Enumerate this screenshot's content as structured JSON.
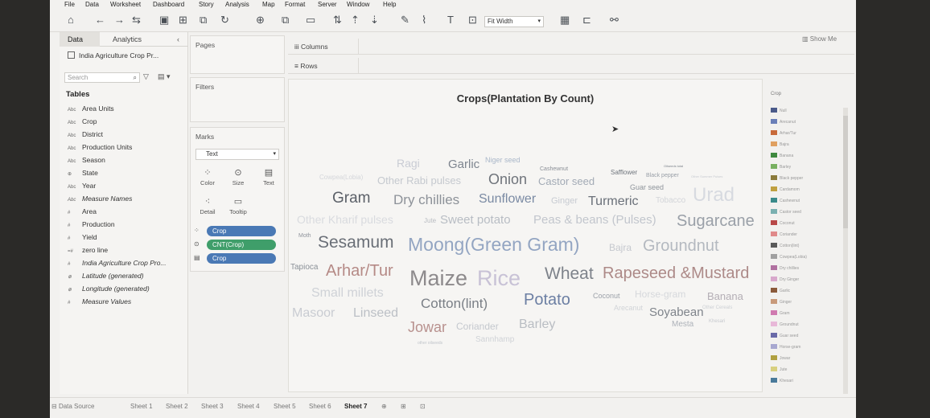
{
  "menu": [
    "File",
    "Data",
    "Worksheet",
    "Dashboard",
    "Story",
    "Analysis",
    "Map",
    "Format",
    "Server",
    "Window",
    "Help"
  ],
  "toolbar": {
    "fit": "Fit Width",
    "show_me": "Show Me"
  },
  "left_panel": {
    "tabs": {
      "data": "Data",
      "analytics": "Analytics"
    },
    "data_source": "India Agriculture Crop Pr...",
    "search_placeholder": "Search",
    "tables_heading": "Tables",
    "fields": [
      {
        "type": "Abc",
        "name": "Area Units",
        "italic": false
      },
      {
        "type": "Abc",
        "name": "Crop",
        "italic": false
      },
      {
        "type": "Abc",
        "name": "District",
        "italic": false
      },
      {
        "type": "Abc",
        "name": "Production Units",
        "italic": false
      },
      {
        "type": "Abc",
        "name": "Season",
        "italic": false
      },
      {
        "type": "globe",
        "name": "State",
        "italic": false
      },
      {
        "type": "Abc",
        "name": "Year",
        "italic": false
      },
      {
        "type": "Abc",
        "name": "Measure Names",
        "italic": true
      },
      {
        "type": "#",
        "name": "Area",
        "italic": false
      },
      {
        "type": "#",
        "name": "Production",
        "italic": false
      },
      {
        "type": "#",
        "name": "Yield",
        "italic": false
      },
      {
        "type": "=#",
        "name": "zero line",
        "italic": false
      },
      {
        "type": "#",
        "name": "India Agriculture Crop Pro...",
        "italic": true
      },
      {
        "type": "globe",
        "name": "Latitude (generated)",
        "italic": true
      },
      {
        "type": "globe",
        "name": "Longitude (generated)",
        "italic": true
      },
      {
        "type": "#",
        "name": "Measure Values",
        "italic": true
      }
    ]
  },
  "cards": {
    "pages": "Pages",
    "filters": "Filters",
    "marks": "Marks",
    "mark_type": "Text"
  },
  "mark_buttons": [
    "Color",
    "Size",
    "Text",
    "Detail",
    "Tooltip"
  ],
  "mark_pills": [
    {
      "label": "Crop",
      "color": "#4a79b5"
    },
    {
      "label": "CNT(Crop)",
      "color": "#3f9e6a"
    },
    {
      "label": "Crop",
      "color": "#4a79b5"
    }
  ],
  "shelves": {
    "columns": "Columns",
    "rows": "Rows"
  },
  "viz": {
    "title": "Crops(Plantation By Count)"
  },
  "chart_data": {
    "type": "word cloud",
    "words": [
      {
        "text": "Ragi",
        "color": "#c9ccd4"
      },
      {
        "text": "Garlic",
        "color": "#7e858f"
      },
      {
        "text": "Niger seed",
        "color": "#a9b6c8"
      },
      {
        "text": "Cashewnut",
        "color": "#8a8f96"
      },
      {
        "text": "Safflower",
        "color": "#6f757d"
      },
      {
        "text": "Black pepper",
        "color": "#9aa0a8"
      },
      {
        "text": "Other Summer Pulses",
        "color": "#c7cad0"
      },
      {
        "text": "Oilseeds total",
        "color": "#7d838b"
      },
      {
        "text": "Cowpea(Lobia)",
        "color": "#d4d6da"
      },
      {
        "text": "Other Rabi pulses",
        "color": "#c5c9cf"
      },
      {
        "text": "Onion",
        "color": "#6f747b"
      },
      {
        "text": "Castor seed",
        "color": "#a2aab5"
      },
      {
        "text": "Guar seed",
        "color": "#8e949b"
      },
      {
        "text": "Gram",
        "color": "#5b6068"
      },
      {
        "text": "Dry chillies",
        "color": "#8d9299"
      },
      {
        "text": "Sunflower",
        "color": "#7a8aa3"
      },
      {
        "text": "Ginger",
        "color": "#c7cbd2"
      },
      {
        "text": "Turmeric",
        "color": "#6a7079"
      },
      {
        "text": "Tobacco",
        "color": "#d3d5d9"
      },
      {
        "text": "Urad",
        "color": "#d7dae0"
      },
      {
        "text": "Other Kharif pulses",
        "color": "#d9dbdf"
      },
      {
        "text": "Jute",
        "color": "#b9bcc2"
      },
      {
        "text": "Sweet potato",
        "color": "#b8bdc4"
      },
      {
        "text": "Peas & beans (Pulses)",
        "color": "#c2c6cd"
      },
      {
        "text": "Sugarcane",
        "color": "#9aa0a8"
      },
      {
        "text": "Moth",
        "color": "#8f949b"
      },
      {
        "text": "Sesamum",
        "color": "#6a6f77"
      },
      {
        "text": "Moong(Green Gram)",
        "color": "#93a5c2"
      },
      {
        "text": "Bajra",
        "color": "#c5c8ce"
      },
      {
        "text": "Groundnut",
        "color": "#b4b9c0"
      },
      {
        "text": "Tapioca",
        "color": "#8b9198"
      },
      {
        "text": "Arhar/Tur",
        "color": "#b58a86"
      },
      {
        "text": "Maize",
        "color": "#8d8a8c"
      },
      {
        "text": "Rice",
        "color": "#c8c2d6"
      },
      {
        "text": "Wheat",
        "color": "#7d828a"
      },
      {
        "text": "Rapeseed &Mustard",
        "color": "#ad8a88"
      },
      {
        "text": "Small millets",
        "color": "#cfd2d7"
      },
      {
        "text": "Cotton(lint)",
        "color": "#7a7f86"
      },
      {
        "text": "Potato",
        "color": "#6c7fa3"
      },
      {
        "text": "Coconut",
        "color": "#9ba0a8"
      },
      {
        "text": "Horse-gram",
        "color": "#d6d8dc"
      },
      {
        "text": "Banana",
        "color": "#b4aeb5"
      },
      {
        "text": "Masoor",
        "color": "#c9ccd2"
      },
      {
        "text": "Linseed",
        "color": "#bcc0c6"
      },
      {
        "text": "Jowar",
        "color": "#b8918e"
      },
      {
        "text": "Coriander",
        "color": "#c4c8ce"
      },
      {
        "text": "Barley",
        "color": "#b9bdc3"
      },
      {
        "text": "Soyabean",
        "color": "#7f848b"
      },
      {
        "text": "Other Cereals",
        "color": "#cdd0d5"
      },
      {
        "text": "Khesari",
        "color": "#c6c9ce"
      },
      {
        "text": "Mesta",
        "color": "#adb2b9"
      },
      {
        "text": "Arecanut",
        "color": "#d1d4d8"
      },
      {
        "text": "other oilseeds",
        "color": "#c0c4ca"
      },
      {
        "text": "Sannhamp",
        "color": "#d0d3d7"
      }
    ]
  },
  "legend": {
    "title": "Crop",
    "items": [
      {
        "label": "Null",
        "color": "#4a5a8a"
      },
      {
        "label": "Arecanut",
        "color": "#6a7fb8"
      },
      {
        "label": "Arhar/Tur",
        "color": "#c86a3a"
      },
      {
        "label": "Bajra",
        "color": "#e0a060"
      },
      {
        "label": "Banana",
        "color": "#3f8a3f"
      },
      {
        "label": "Barley",
        "color": "#78b060"
      },
      {
        "label": "Black pepper",
        "color": "#8a7a3a"
      },
      {
        "label": "Cardamom",
        "color": "#c0a040"
      },
      {
        "label": "Cashewnut",
        "color": "#3a8a8a"
      },
      {
        "label": "Castor seed",
        "color": "#7ab0b0"
      },
      {
        "label": "Coconut",
        "color": "#b84848"
      },
      {
        "label": "Coriander",
        "color": "#e08a8a"
      },
      {
        "label": "Cotton(lint)",
        "color": "#5a5a5a"
      },
      {
        "label": "Cowpea(Lobia)",
        "color": "#a0a0a0"
      },
      {
        "label": "Dry chillies",
        "color": "#b070a0"
      },
      {
        "label": "Dry Ginger",
        "color": "#d8a8cc"
      },
      {
        "label": "Garlic",
        "color": "#8a5a3a"
      },
      {
        "label": "Ginger",
        "color": "#c89a7a"
      },
      {
        "label": "Gram",
        "color": "#d07ab0"
      },
      {
        "label": "Groundnut",
        "color": "#e8b8d8"
      },
      {
        "label": "Guar seed",
        "color": "#6a6aa8"
      },
      {
        "label": "Horse-gram",
        "color": "#a8a8d0"
      },
      {
        "label": "Jowar",
        "color": "#b0a040"
      },
      {
        "label": "Jute",
        "color": "#d8d080"
      },
      {
        "label": "Khesari",
        "color": "#4a7a9a"
      }
    ]
  },
  "status": {
    "data_source": "Data Source",
    "sheets": [
      "Sheet 1",
      "Sheet 2",
      "Sheet 3",
      "Sheet 4",
      "Sheet 5",
      "Sheet 6",
      "Sheet 7"
    ]
  }
}
